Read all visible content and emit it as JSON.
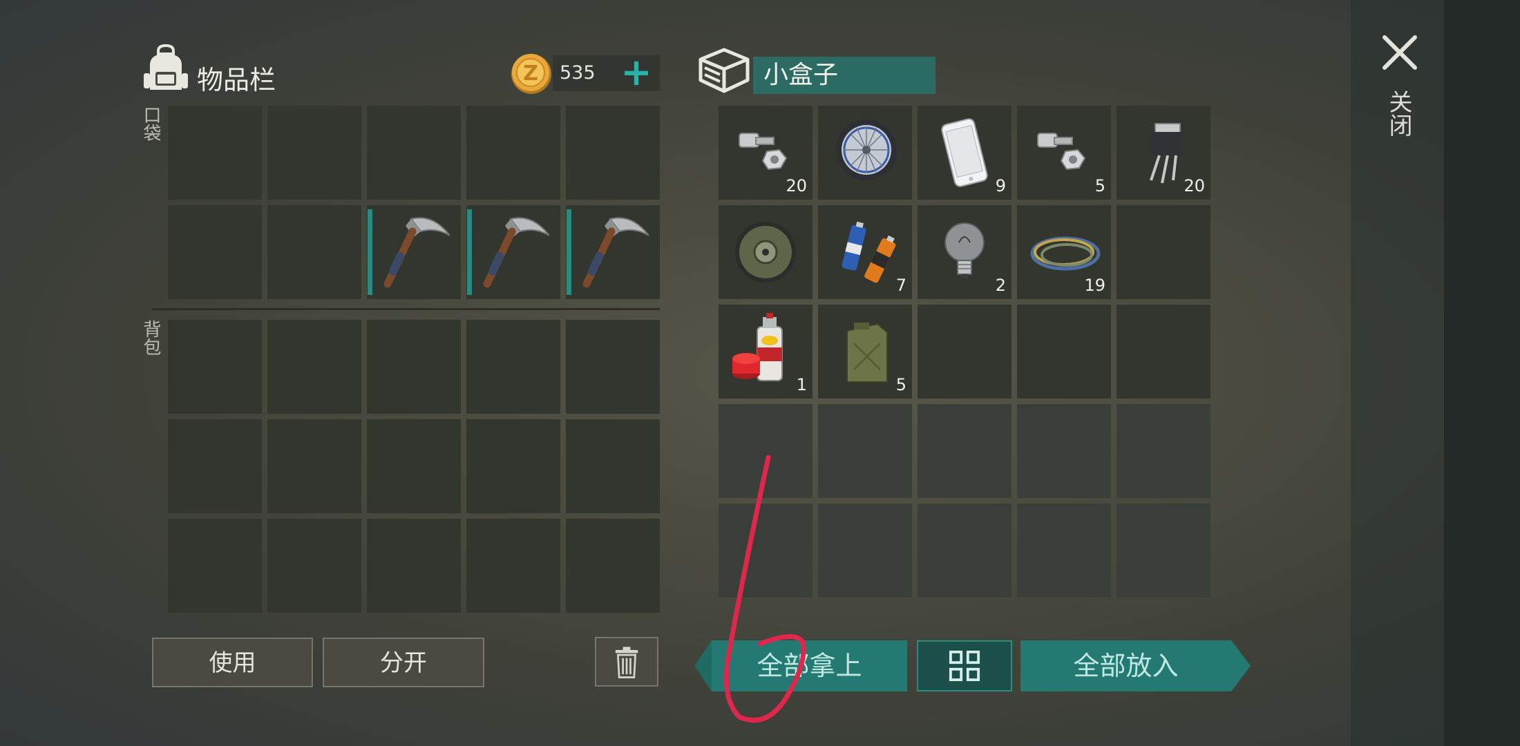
{
  "inventory": {
    "title": "物品栏",
    "coins": "535",
    "pocket_label": "口袋",
    "backpack_label": "背包",
    "pocket_slots": [
      {
        "icon": "",
        "qty": ""
      },
      {
        "icon": "",
        "qty": ""
      },
      {
        "icon": "",
        "qty": ""
      },
      {
        "icon": "",
        "qty": ""
      },
      {
        "icon": "",
        "qty": ""
      },
      {
        "icon": "",
        "qty": ""
      },
      {
        "icon": "",
        "qty": ""
      },
      {
        "icon": "pickaxe-icon",
        "qty": "",
        "durability": true
      },
      {
        "icon": "pickaxe-icon",
        "qty": "",
        "durability": true
      },
      {
        "icon": "pickaxe-icon",
        "qty": "",
        "durability": true
      }
    ],
    "backpack_slots": [
      {
        "icon": "",
        "qty": ""
      },
      {
        "icon": "",
        "qty": ""
      },
      {
        "icon": "",
        "qty": ""
      },
      {
        "icon": "",
        "qty": ""
      },
      {
        "icon": "",
        "qty": ""
      },
      {
        "icon": "",
        "qty": ""
      },
      {
        "icon": "",
        "qty": ""
      },
      {
        "icon": "",
        "qty": ""
      },
      {
        "icon": "",
        "qty": ""
      },
      {
        "icon": "",
        "qty": ""
      },
      {
        "icon": "",
        "qty": ""
      },
      {
        "icon": "",
        "qty": ""
      },
      {
        "icon": "",
        "qty": ""
      },
      {
        "icon": "",
        "qty": ""
      },
      {
        "icon": "",
        "qty": ""
      }
    ],
    "use_label": "使用",
    "split_label": "分开"
  },
  "container": {
    "name": "小盒子",
    "slots": [
      {
        "icon": "bolts-icon",
        "qty": "20"
      },
      {
        "icon": "wheel-icon",
        "qty": ""
      },
      {
        "icon": "smartphone-icon",
        "qty": "9"
      },
      {
        "icon": "bolts-icon",
        "qty": "5"
      },
      {
        "icon": "transistor-icon",
        "qty": "20"
      },
      {
        "icon": "engine-part-icon",
        "qty": ""
      },
      {
        "icon": "batteries-icon",
        "qty": "7"
      },
      {
        "icon": "light-bulb-icon",
        "qty": "2"
      },
      {
        "icon": "wire-coil-icon",
        "qty": "19"
      },
      {
        "icon": "",
        "qty": ""
      },
      {
        "icon": "spray-paint-icon",
        "qty": "1"
      },
      {
        "icon": "jerrycan-icon",
        "qty": "5"
      },
      {
        "icon": "",
        "qty": ""
      },
      {
        "icon": "",
        "qty": ""
      },
      {
        "icon": "",
        "qty": ""
      },
      {
        "icon": "",
        "qty": "",
        "dim": true
      },
      {
        "icon": "",
        "qty": "",
        "dim": true
      },
      {
        "icon": "",
        "qty": "",
        "dim": true
      },
      {
        "icon": "",
        "qty": "",
        "dim": true
      },
      {
        "icon": "",
        "qty": "",
        "dim": true
      },
      {
        "icon": "",
        "qty": "",
        "dim": true
      },
      {
        "icon": "",
        "qty": "",
        "dim": true
      },
      {
        "icon": "",
        "qty": "",
        "dim": true
      },
      {
        "icon": "",
        "qty": "",
        "dim": true
      },
      {
        "icon": "",
        "qty": "",
        "dim": true
      }
    ],
    "take_all_label": "全部拿上",
    "put_all_label": "全部放入"
  },
  "close_label": "关闭",
  "colors": {
    "accent": "#247a72",
    "plus": "#27b3a5",
    "scribble": "#e0264a"
  }
}
